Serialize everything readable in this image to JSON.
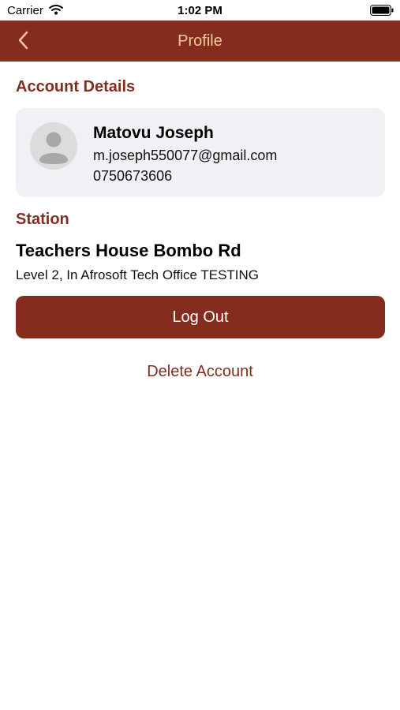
{
  "status_bar": {
    "carrier": "Carrier",
    "time": "1:02 PM",
    "icons": [
      "wifi-icon",
      "battery-icon"
    ]
  },
  "nav": {
    "title": "Profile",
    "back_icon": "chevron-left-icon"
  },
  "account": {
    "section_title": "Account Details",
    "avatar_icon": "person-avatar-icon",
    "name": "Matovu Joseph",
    "email": "m.joseph550077@gmail.com",
    "phone": "0750673606"
  },
  "station": {
    "section_title": "Station",
    "name": "Teachers House Bombo Rd",
    "address": "Level 2, In Afrosoft Tech Office TESTING"
  },
  "actions": {
    "logout_label": "Log Out",
    "delete_label": "Delete Account"
  },
  "colors": {
    "brand": "#842d1f",
    "nav_title": "#f7c79a",
    "card_background": "#f0f0f5"
  }
}
